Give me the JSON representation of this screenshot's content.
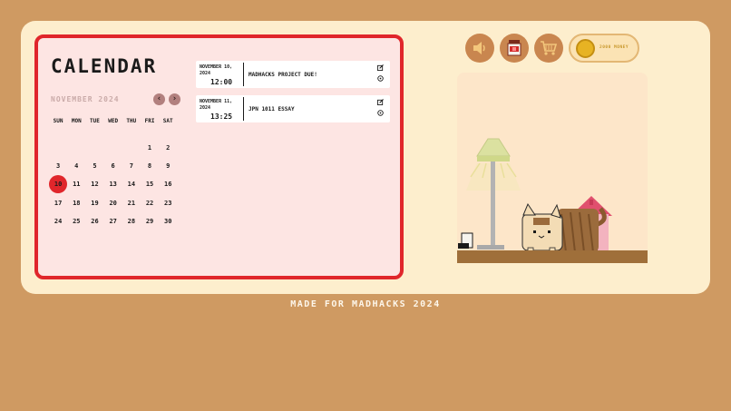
{
  "calendar": {
    "title": "CALENDAR",
    "month": "NOVEMBER 2024",
    "prev_label": "‹",
    "next_label": "›",
    "weekdays": [
      "SUN",
      "MON",
      "TUE",
      "WED",
      "THU",
      "FRI",
      "SAT"
    ],
    "days": [
      "",
      "",
      "",
      "",
      "",
      "1",
      "2",
      "3",
      "4",
      "5",
      "6",
      "7",
      "8",
      "9",
      "10",
      "11",
      "12",
      "13",
      "14",
      "15",
      "16",
      "17",
      "18",
      "19",
      "20",
      "21",
      "22",
      "23",
      "24",
      "25",
      "26",
      "27",
      "28",
      "29",
      "30"
    ],
    "today": "10"
  },
  "events": [
    {
      "date": "NOVEMBER 10, 2024",
      "time": "12:00",
      "title": "MADHACKS PROJECT DUE!"
    },
    {
      "date": "NOVEMBER 11, 2024",
      "time": "13:25",
      "title": "JPN 1011 ESSAY"
    }
  ],
  "toolbar": {
    "sound_icon": "speaker-icon",
    "jar_icon": "jam-jar-icon",
    "shop_icon": "shopping-cart-icon",
    "money_label": "2000 MONEY"
  },
  "footer": {
    "text": "MADE FOR MADHACKS 2024"
  },
  "colors": {
    "accent": "#e0262b",
    "background": "#cf9a62",
    "panel": "#fdeecd"
  }
}
